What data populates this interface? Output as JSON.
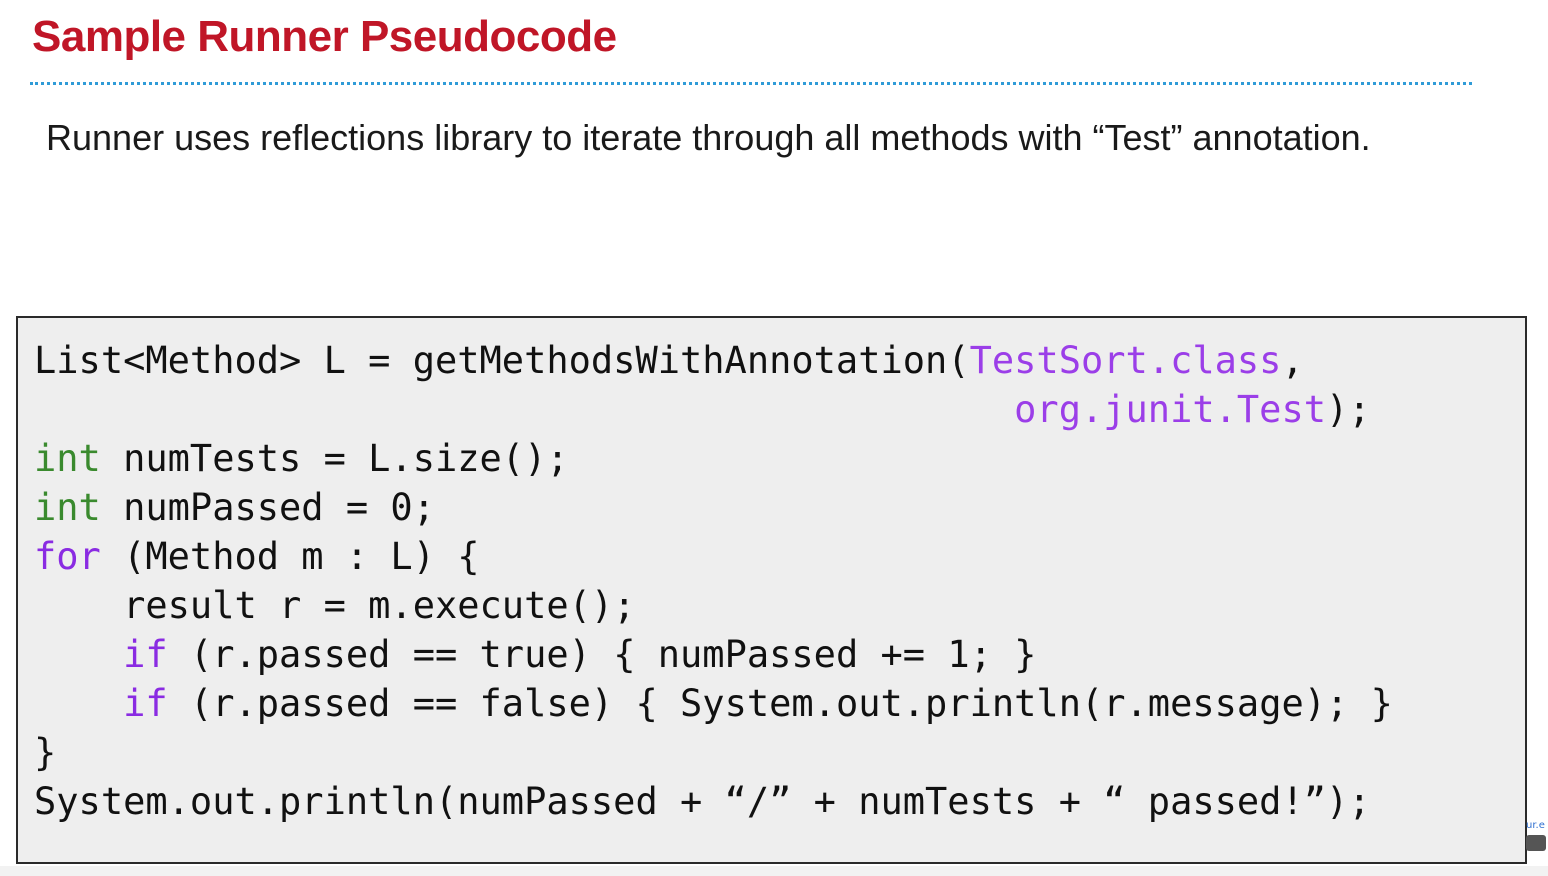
{
  "slide": {
    "title": "Sample Runner Pseudocode",
    "body_text": "Runner uses reflections library to iterate through all methods with “Test” annotation.",
    "accent_color": "#c01627",
    "divider_color": "#2f9bd7"
  },
  "code": {
    "lines": [
      [
        {
          "t": "List<Method> L = getMethodsWithAnnotation(",
          "c": "plain"
        },
        {
          "t": "TestSort.class",
          "c": "lit-purple"
        },
        {
          "t": ",",
          "c": "plain"
        }
      ],
      [
        {
          "t": "                                            ",
          "c": "plain"
        },
        {
          "t": "org.junit.Test",
          "c": "lit-purple"
        },
        {
          "t": ");",
          "c": "plain"
        }
      ],
      [
        {
          "t": "int",
          "c": "kw-green"
        },
        {
          "t": " numTests = L.size();",
          "c": "plain"
        }
      ],
      [
        {
          "t": "int",
          "c": "kw-green"
        },
        {
          "t": " numPassed = 0;",
          "c": "plain"
        }
      ],
      [
        {
          "t": "for",
          "c": "kw-purple"
        },
        {
          "t": " (Method m : L) {",
          "c": "plain"
        }
      ],
      [
        {
          "t": "    result r = m.execute();",
          "c": "plain"
        }
      ],
      [
        {
          "t": "    ",
          "c": "plain"
        },
        {
          "t": "if",
          "c": "kw-purple"
        },
        {
          "t": " (r.passed == true) { numPassed += 1; }",
          "c": "plain"
        }
      ],
      [
        {
          "t": "    ",
          "c": "plain"
        },
        {
          "t": "if",
          "c": "kw-purple"
        },
        {
          "t": " (r.passed == false) { System.out.println(r.message); }",
          "c": "plain"
        }
      ],
      [
        {
          "t": "}",
          "c": "plain"
        }
      ],
      [
        {
          "t": "System.out.println(numPassed + “/” + numTests + “ passed!”);",
          "c": "plain"
        }
      ]
    ]
  },
  "license": {
    "url_fragment": "ur.e",
    "icon": "creative-commons-icon"
  }
}
